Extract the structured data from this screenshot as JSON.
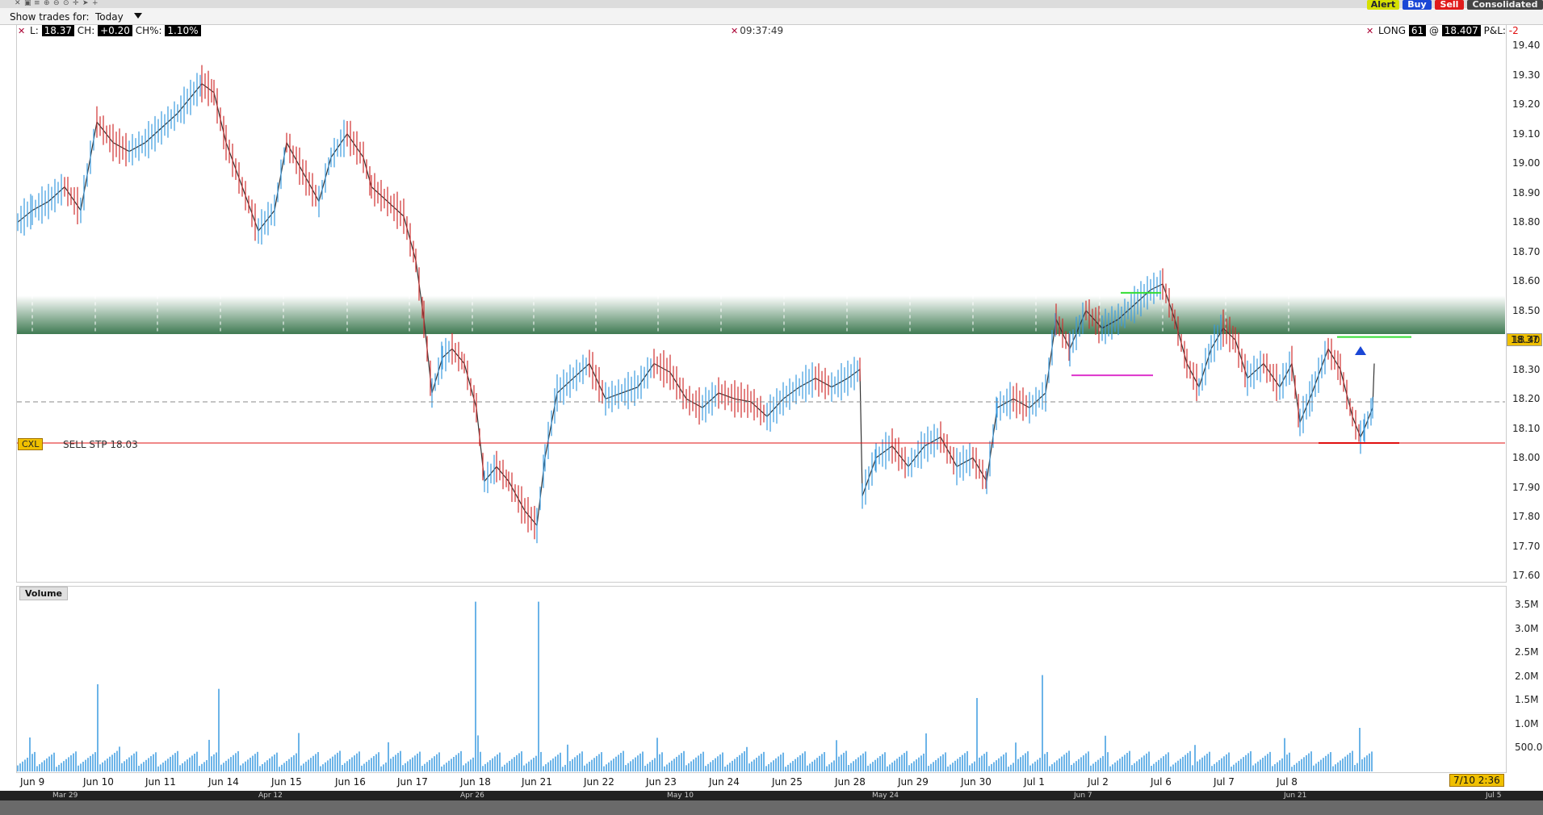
{
  "toolbar": {
    "icons": [
      "close-icon",
      "window-icon",
      "bars-icon",
      "zoom-in-icon",
      "zoom-out-icon",
      "zoom-fit-icon",
      "crosshair-icon",
      "cursor-icon",
      "plus-icon"
    ]
  },
  "trades": {
    "label": "Show trades for:",
    "value": "Today"
  },
  "buttons": {
    "alert": "Alert",
    "buy": "Buy",
    "sell": "Sell",
    "consolidated": "Consolidated"
  },
  "header": {
    "last_label": "L:",
    "last": "18.37",
    "ch_label": "CH:",
    "ch": "+0.20",
    "chp_label": "CH%:",
    "chp": "1.10%",
    "clock": "09:37:49"
  },
  "position": {
    "side": "LONG",
    "qty": "61",
    "at": "@",
    "avg": "18.407",
    "pnl_label": "P&L:",
    "pnl": "-2"
  },
  "order": {
    "cxl": "CXL",
    "text": "SELL STP 18.03"
  },
  "volume": {
    "label": "Volume",
    "axis": [
      "3.5M",
      "3.0M",
      "2.5M",
      "2.0M",
      "1.5M",
      "1.0M",
      "500.0K"
    ]
  },
  "price_axis": [
    "19.40",
    "19.30",
    "19.20",
    "19.10",
    "19.00",
    "18.90",
    "18.80",
    "18.70",
    "18.60",
    "18.50",
    "18.40",
    "18.30",
    "18.20",
    "18.10",
    "18.00",
    "17.90",
    "17.80",
    "17.70",
    "17.60"
  ],
  "last_box": "18.37",
  "timestamp": "7/10 2:36",
  "dates": [
    "Jun 9",
    "Jun 10",
    "Jun 11",
    "Jun 14",
    "Jun 15",
    "Jun 16",
    "Jun 17",
    "Jun 18",
    "Jun 21",
    "Jun 22",
    "Jun 23",
    "Jun 24",
    "Jun 25",
    "Jun 28",
    "Jun 29",
    "Jun 30",
    "Jul 1",
    "Jul 2",
    "Jul 6",
    "Jul 7",
    "Jul 8"
  ],
  "overview_dates": [
    "Mar 29",
    "Apr 12",
    "Apr 26",
    "May 10",
    "May 24",
    "Jun 7",
    "Jun 21",
    "Jul 5"
  ],
  "colors": {
    "up": "#3a9be0",
    "down": "#d03030",
    "zone": "#3f7a52",
    "stop": "#e01010"
  }
}
